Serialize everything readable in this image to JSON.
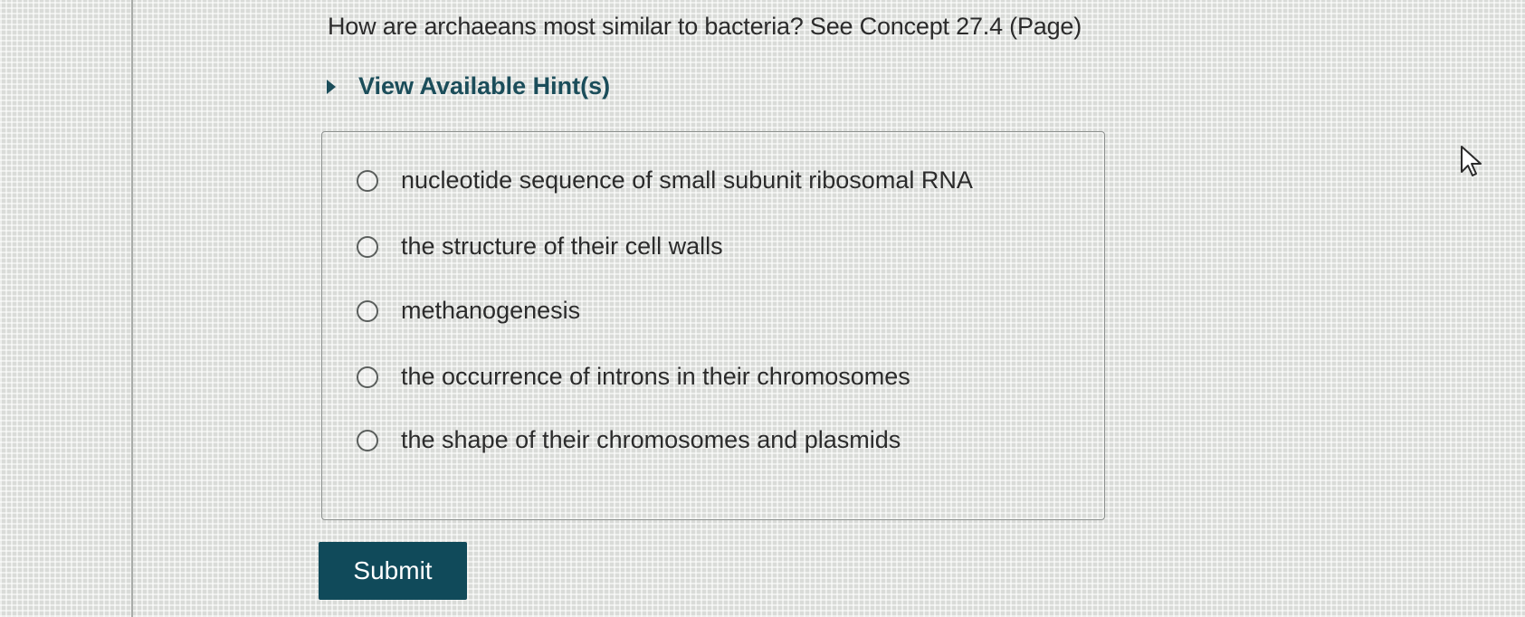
{
  "question": {
    "text": "How are archaeans most similar to bacteria? See Concept 27.4 (Page)"
  },
  "hint": {
    "label": "View Available Hint(s)",
    "icon": "triangle-right-icon"
  },
  "options": [
    {
      "text": "nucleotide sequence of small subunit ribosomal RNA",
      "selected": false
    },
    {
      "text": "the structure of their cell walls",
      "selected": false
    },
    {
      "text": "methanogenesis",
      "selected": false
    },
    {
      "text": "the occurrence of introns in their chromosomes",
      "selected": false
    },
    {
      "text": "the shape of their chromosomes and plasmids",
      "selected": false
    }
  ],
  "submit": {
    "label": "Submit"
  },
  "colors": {
    "accent": "#104a5a",
    "hint_text": "#1b4d5a"
  }
}
